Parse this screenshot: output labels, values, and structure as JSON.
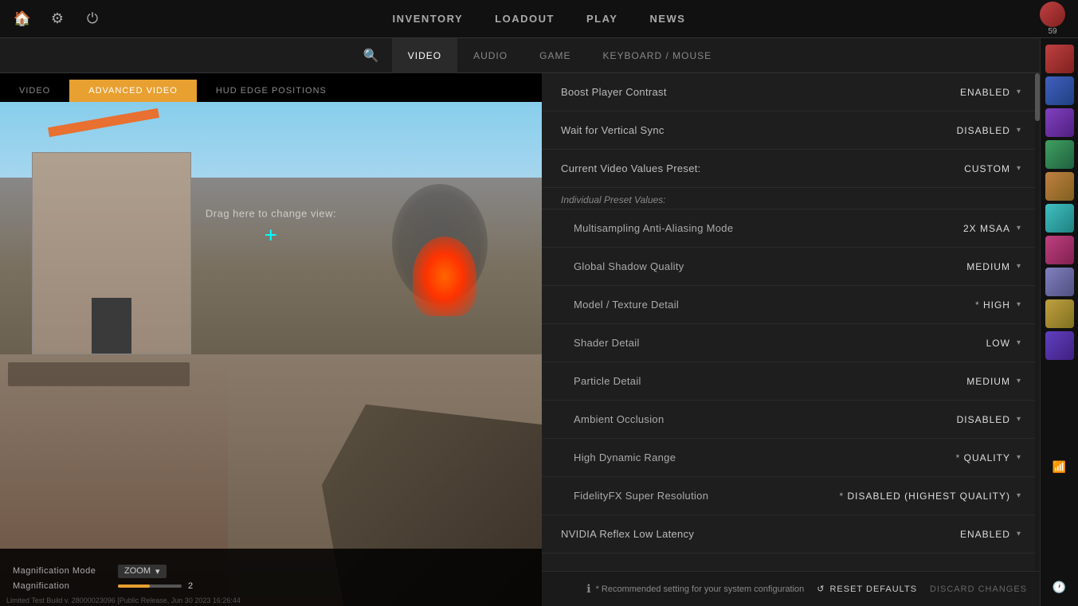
{
  "topnav": {
    "home_icon": "🏠",
    "settings_icon": "⚙",
    "power_icon": "⏻",
    "menu_items": [
      "INVENTORY",
      "LOADOUT",
      "PLAY",
      "NEWS"
    ],
    "friend_count": "59"
  },
  "settings_nav": {
    "search_placeholder": "Search",
    "tabs": [
      "VIDEO",
      "AUDIO",
      "GAME",
      "KEYBOARD / MOUSE"
    ],
    "active_tab": "VIDEO"
  },
  "video_tabs": {
    "tabs": [
      "VIDEO",
      "ADVANCED VIDEO",
      "HUD EDGE POSITIONS"
    ],
    "active_tab": "ADVANCED VIDEO"
  },
  "preview": {
    "drag_message": "Drag here to change view:",
    "crosshair": "+"
  },
  "magnification": {
    "mode_label": "Magnification Mode",
    "mode_value": "ZOOM",
    "mag_label": "Magnification",
    "mag_value": "2"
  },
  "version": "Limited Test Build v. 28000023096 [Public Release, Jun 30 2023 16:26:44",
  "settings": {
    "rows": [
      {
        "label": "Boost Player Contrast",
        "value": "ENABLED",
        "starred": false
      },
      {
        "label": "Wait for Vertical Sync",
        "value": "DISABLED",
        "starred": false
      },
      {
        "label": "Current Video Values Preset:",
        "value": "CUSTOM",
        "starred": false
      }
    ],
    "preset_label": "Individual Preset Values:",
    "preset_rows": [
      {
        "label": "Multisampling Anti-Aliasing Mode",
        "value": "2X MSAA",
        "starred": false
      },
      {
        "label": "Global Shadow Quality",
        "value": "MEDIUM",
        "starred": false
      },
      {
        "label": "Model / Texture Detail",
        "value": "HIGH",
        "starred": true
      },
      {
        "label": "Shader Detail",
        "value": "LOW",
        "starred": false
      },
      {
        "label": "Particle Detail",
        "value": "MEDIUM",
        "starred": false
      },
      {
        "label": "Ambient Occlusion",
        "value": "DISABLED",
        "starred": false
      },
      {
        "label": "High Dynamic Range",
        "value": "QUALITY",
        "starred": true
      },
      {
        "label": "FidelityFX Super Resolution",
        "value": "DISABLED (HIGHEST QUALITY)",
        "starred": true
      },
      {
        "label": "NVIDIA Reflex Low Latency",
        "value": "ENABLED",
        "starred": false
      }
    ]
  },
  "bottom_bar": {
    "recommended_text": "* Recommended setting for your system configuration",
    "reset_label": "RESET DEFAULTS",
    "discard_label": "DISCARD CHANGES"
  },
  "sidebar": {
    "avatars": [
      "av1",
      "av2",
      "av3",
      "av4",
      "av5",
      "av6",
      "av7",
      "av8",
      "av9",
      "av10"
    ],
    "wifi_icon": "📶",
    "clock_icon": "🕐"
  }
}
